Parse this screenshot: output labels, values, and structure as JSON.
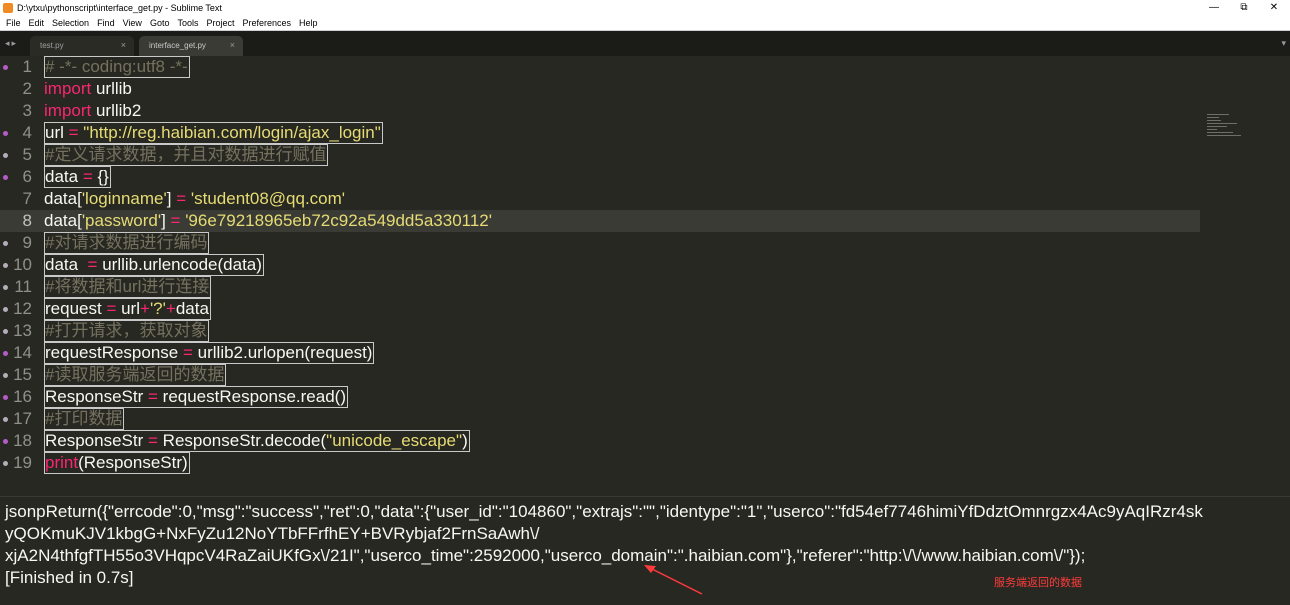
{
  "window": {
    "title": "D:\\ytxu\\pythonscript\\interface_get.py - Sublime Text",
    "min": "—",
    "max": "⧉",
    "close": "✕"
  },
  "menu": [
    "File",
    "Edit",
    "Selection",
    "Find",
    "View",
    "Goto",
    "Tools",
    "Project",
    "Preferences",
    "Help"
  ],
  "tabs": [
    {
      "label": "test.py",
      "close": "×"
    },
    {
      "label": "interface_get.py",
      "close": "×"
    }
  ],
  "tab_nav": "◂▸",
  "tab_menu": "▾",
  "editor": {
    "line_numbers": [
      "1",
      "2",
      "3",
      "4",
      "5",
      "6",
      "7",
      "8",
      "9",
      "10",
      "11",
      "12",
      "13",
      "14",
      "15",
      "16",
      "17",
      "18",
      "19"
    ],
    "l1": "# -*- coding:utf8 -*-",
    "l2_kw": "import",
    "l2_rest": " urllib",
    "l3_kw": "import",
    "l3_rest": " urllib2",
    "l4_a": "url ",
    "l4_op": "=",
    "l4_b": " ",
    "l4_str": "\"http://reg.haibian.com/login/ajax_login\"",
    "l5": "#定义请求数据，并且对数据进行赋值",
    "l6_a": "data ",
    "l6_op": "=",
    "l6_b": " {}",
    "l7_a": "data[",
    "l7_s1": "'loginname'",
    "l7_b": "] ",
    "l7_op": "=",
    "l7_c": " ",
    "l7_s2": "'student08@qq.com'",
    "l8_a": "data[",
    "l8_s1": "'password'",
    "l8_b": "] ",
    "l8_op": "=",
    "l8_c": " ",
    "l8_s2": "'96e79218965eb72c92a549dd5a330112'",
    "l9": "#对请求数据进行编码",
    "l10_a": "data  ",
    "l10_op": "=",
    "l10_b": " urllib.urlencode(data)",
    "l11": "#将数据和url进行连接",
    "l12_a": "request ",
    "l12_op1": "=",
    "l12_b": " url",
    "l12_op2": "+",
    "l12_s": "'?'",
    "l12_op3": "+",
    "l12_c": "data",
    "l13": "#打开请求，获取对象",
    "l14_a": "requestResponse ",
    "l14_op": "=",
    "l14_b": " urllib2.urlopen(request)",
    "l15": "#读取服务端返回的数据",
    "l16_a": "ResponseStr ",
    "l16_op": "=",
    "l16_b": " requestResponse.read()",
    "l17": "#打印数据",
    "l18_a": "ResponseStr ",
    "l18_op": "=",
    "l18_b": " ResponseStr.decode(",
    "l18_s": "\"unicode_escape\"",
    "l18_c": ")",
    "l19_kw": "print",
    "l19_rest": "(ResponseStr)"
  },
  "output": {
    "line1": "jsonpReturn({\"errcode\":0,\"msg\":\"success\",\"ret\":0,\"data\":{\"user_id\":\"104860\",\"extrajs\":\"\",\"identype\":\"1\",\"userco\":\"fd54ef7746himiYfDdztOmnrgzx4Ac9yAqIRzr4sk",
    "line2": "yQOKmuKJV1kbgG+NxFyZu12NoYTbFFrfhEY+BVRybjaf2FrnSaAwh\\/",
    "line3": "xjA2N4thfgfTH55o3VHqpcV4RaZaiUKfGx\\/21I\",\"userco_time\":2592000,\"userco_domain\":\".haibian.com\"},\"referer\":\"http:\\/\\/www.haibian.com\\/\"});",
    "line4": "[Finished in 0.7s]"
  },
  "annotation": "服务端返回的数据",
  "colors": {
    "background": "#272822",
    "keyword": "#f92672",
    "string": "#e6db74",
    "comment": "#75715e",
    "annotation": "#ff3b3b"
  }
}
